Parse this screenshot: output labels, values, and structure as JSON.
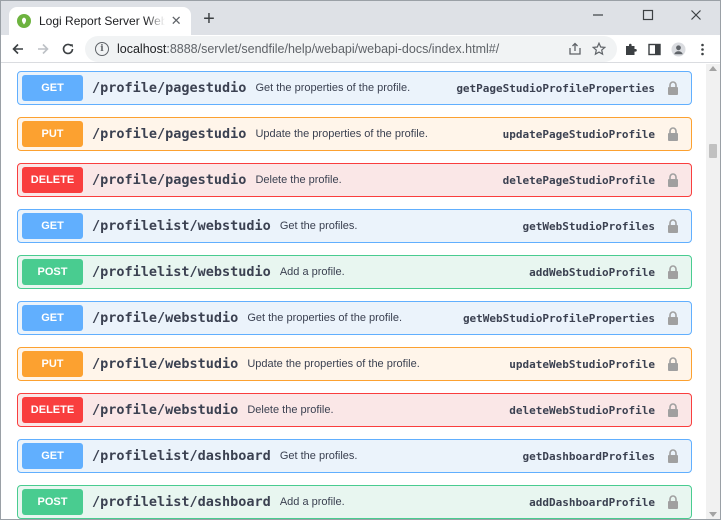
{
  "browser": {
    "tab_title": "Logi Report Server Web API Docs",
    "new_tab_label": "+",
    "url_host": "localhost",
    "url_rest": ":8888/servlet/sendfile/help/webapi/webapi-docs/index.html#/"
  },
  "operations": [
    {
      "method": "GET",
      "path": "/profile/pagestudio",
      "summary": "Get the properties of the profile.",
      "operation_id": "getPageStudioProfileProperties"
    },
    {
      "method": "PUT",
      "path": "/profile/pagestudio",
      "summary": "Update the properties of the profile.",
      "operation_id": "updatePageStudioProfile"
    },
    {
      "method": "DELETE",
      "path": "/profile/pagestudio",
      "summary": "Delete the profile.",
      "operation_id": "deletePageStudioProfile"
    },
    {
      "method": "GET",
      "path": "/profilelist/webstudio",
      "summary": "Get the profiles.",
      "operation_id": "getWebStudioProfiles"
    },
    {
      "method": "POST",
      "path": "/profilelist/webstudio",
      "summary": "Add a profile.",
      "operation_id": "addWebStudioProfile"
    },
    {
      "method": "GET",
      "path": "/profile/webstudio",
      "summary": "Get the properties of the profile.",
      "operation_id": "getWebStudioProfileProperties"
    },
    {
      "method": "PUT",
      "path": "/profile/webstudio",
      "summary": "Update the properties of the profile.",
      "operation_id": "updateWebStudioProfile"
    },
    {
      "method": "DELETE",
      "path": "/profile/webstudio",
      "summary": "Delete the profile.",
      "operation_id": "deleteWebStudioProfile"
    },
    {
      "method": "GET",
      "path": "/profilelist/dashboard",
      "summary": "Get the profiles.",
      "operation_id": "getDashboardProfiles"
    },
    {
      "method": "POST",
      "path": "/profilelist/dashboard",
      "summary": "Add a profile.",
      "operation_id": "addDashboardProfile"
    }
  ],
  "colors": {
    "get": "#61affe",
    "put": "#fca130",
    "delete": "#f93e3e",
    "post": "#49cc90",
    "text": "#3b4151"
  },
  "icons": {
    "tab_favicon": "spring-leaf-icon",
    "tab_close": "close-icon",
    "minimize": "minimize-icon",
    "maximize": "maximize-icon",
    "close_window": "close-window-icon",
    "back": "back-arrow-icon",
    "forward": "forward-arrow-icon",
    "reload": "reload-icon",
    "site_info": "info-icon",
    "share": "share-icon",
    "bookmark": "star-icon",
    "extensions": "puzzle-icon",
    "side_panel": "side-panel-icon",
    "profile": "profile-avatar-icon",
    "menu": "kebab-menu-icon",
    "lock": "lock-icon"
  }
}
